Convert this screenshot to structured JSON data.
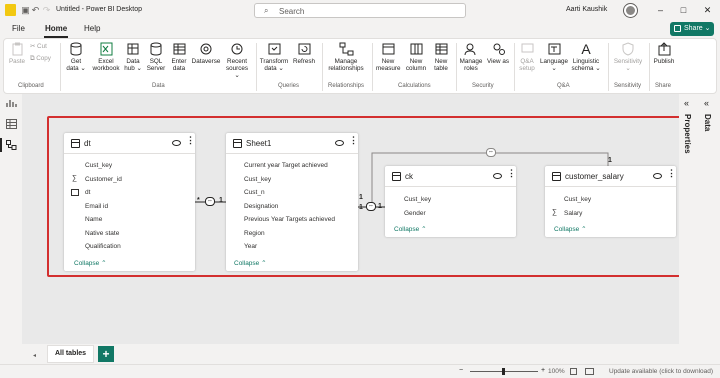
{
  "window": {
    "title": "Untitled - Power BI Desktop",
    "search_label": "Search",
    "user_name": "Aarti Kaushik"
  },
  "menu": {
    "items": [
      "File",
      "Home",
      "Help"
    ],
    "share_label": "Share"
  },
  "ribbon": {
    "clipboard": {
      "paste": "Paste",
      "cut": "Cut",
      "copy": "Copy",
      "group": "Clipboard"
    },
    "data": {
      "get_data": "Get data ⌄",
      "excel": "Excel workbook",
      "data_hub": "Data hub ⌄",
      "sql": "SQL Server",
      "enter": "Enter data",
      "dataverse": "Dataverse",
      "recent": "Recent sources ⌄",
      "group": "Data"
    },
    "queries": {
      "transform": "Transform data ⌄",
      "refresh": "Refresh",
      "group": "Queries"
    },
    "relationships": {
      "manage": "Manage relationships",
      "group": "Relationships"
    },
    "calculations": {
      "measure": "New measure",
      "column": "New column",
      "table": "New table",
      "group": "Calculations"
    },
    "security": {
      "roles": "Manage roles",
      "view_as": "View as",
      "group": "Security"
    },
    "qa": {
      "setup": "Q&A setup",
      "language": "Language ⌄",
      "schema": "Linguistic schema ⌄",
      "group": "Q&A"
    },
    "sensitivity": {
      "label": "Sensitivity ⌄",
      "group": "Sensitivity"
    },
    "share": {
      "publish": "Publish",
      "group": "Share"
    }
  },
  "tables": {
    "dt": {
      "name": "dt",
      "fields": [
        "Cust_key",
        "Customer_id",
        "dt",
        "Email id",
        "Name",
        "Native state",
        "Qualification"
      ],
      "collapse": "Collapse"
    },
    "sheet1": {
      "name": "Sheet1",
      "fields": [
        "Current year Target achieved",
        "Cust_key",
        "Cust_n",
        "Designation",
        "Previous Year Targets achieved",
        "Region",
        "Year"
      ],
      "collapse": "Collapse"
    },
    "ck": {
      "name": "ck",
      "fields": [
        "Cust_key",
        "Gender"
      ],
      "collapse": "Collapse"
    },
    "customer_salary": {
      "name": "customer_salary",
      "fields": [
        "Cust_key",
        "Salary"
      ],
      "collapse": "Collapse"
    }
  },
  "relationships": {
    "many": "*",
    "one": "1"
  },
  "right_pane": {
    "data": "Data",
    "properties": "Properties"
  },
  "bottom": {
    "tab_all": "All tables",
    "add": "+",
    "zoom": "100%",
    "update": "Update available (click to download)"
  },
  "colors": {
    "accent": "#117865",
    "highlight": "#d32f2f"
  }
}
